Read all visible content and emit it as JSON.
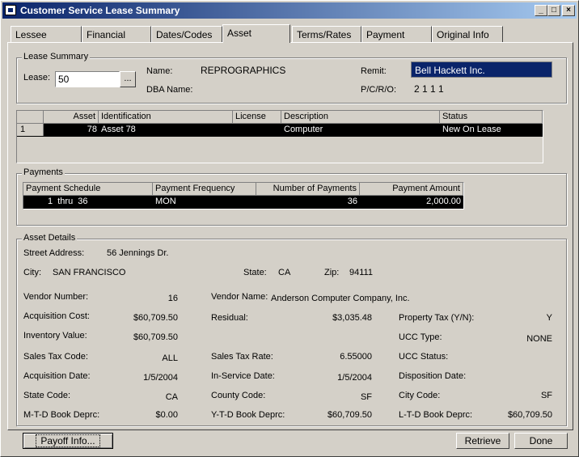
{
  "window": {
    "title": "Customer Service Lease Summary"
  },
  "tabs": [
    {
      "label": "Lessee"
    },
    {
      "label": "Financial"
    },
    {
      "label": "Dates/Codes"
    },
    {
      "label": "Asset"
    },
    {
      "label": "Terms/Rates"
    },
    {
      "label": "Payment"
    },
    {
      "label": "Original Info"
    }
  ],
  "active_tab": "Asset",
  "lease_summary": {
    "group_label": "Lease Summary",
    "lease_label": "Lease:",
    "lease_value": "50",
    "lookup_label": "...",
    "name_label": "Name:",
    "name_value": "REPROGRAPHICS",
    "dba_label": "DBA Name:",
    "dba_value": "",
    "remit_label": "Remit:",
    "remit_value": "Bell Hackett Inc.",
    "pcro_label": "P/C/R/O:",
    "pcro_value": "2 1 1 1"
  },
  "asset_table": {
    "headers": {
      "asset": "Asset",
      "identification": "Identification",
      "license": "License",
      "description": "Description",
      "status": "Status"
    },
    "rows": [
      {
        "row": "1",
        "asset": "78",
        "identification": "Asset 78",
        "license": "",
        "description": "Computer",
        "status": "New On Lease"
      }
    ]
  },
  "payments": {
    "group_label": "Payments",
    "headers": {
      "schedule": "Payment Schedule",
      "frequency": "Payment Frequency",
      "number": "Number of Payments",
      "amount": "Payment Amount"
    },
    "rows": [
      {
        "schedule": "1  thru  36",
        "frequency": "MON",
        "number": "36",
        "amount": "2,000.00"
      }
    ]
  },
  "asset_details": {
    "group_label": "Asset Details",
    "street_label": "Street Address:",
    "street_value": "56 Jennings Dr.",
    "city_label": "City:",
    "city_value": "SAN FRANCISCO",
    "state_label": "State:",
    "state_value": "CA",
    "zip_label": "Zip:",
    "zip_value": "94111",
    "vendor_number_label": "Vendor Number:",
    "vendor_number_value": "16",
    "vendor_name_label": "Vendor Name:",
    "vendor_name_value": "Anderson Computer Company, Inc.",
    "acq_cost_label": "Acquisition Cost:",
    "acq_cost_value": "$60,709.50",
    "residual_label": "Residual:",
    "residual_value": "$3,035.48",
    "prop_tax_label": "Property Tax (Y/N):",
    "prop_tax_value": "Y",
    "inventory_label": "Inventory Value:",
    "inventory_value": "$60,709.50",
    "ucc_type_label": "UCC Type:",
    "ucc_type_value": "NONE",
    "sales_tax_code_label": "Sales Tax Code:",
    "sales_tax_code_value": "ALL",
    "sales_tax_rate_label": "Sales Tax Rate:",
    "sales_tax_rate_value": "6.55000",
    "ucc_status_label": "UCC Status:",
    "ucc_status_value": "",
    "acq_date_label": "Acquisition Date:",
    "acq_date_value": "1/5/2004",
    "in_service_label": "In-Service Date:",
    "in_service_value": "1/5/2004",
    "disposition_label": "Disposition Date:",
    "disposition_value": "",
    "state_code_label": "State Code:",
    "state_code_value": "CA",
    "county_code_label": "County Code:",
    "county_code_value": "SF",
    "city_code_label": "City Code:",
    "city_code_value": "SF",
    "mtd_label": "M-T-D Book Deprc:",
    "mtd_value": "$0.00",
    "ytd_label": "Y-T-D Book Deprc:",
    "ytd_value": "$60,709.50",
    "ltd_label": "L-T-D Book Deprc:",
    "ltd_value": "$60,709.50"
  },
  "buttons": {
    "payoff": "Payoff Info...",
    "retrieve": "Retrieve",
    "done": "Done"
  },
  "colors": {
    "title_start": "#0a246a",
    "title_end": "#a6caf0",
    "remit_bg": "#0a246a",
    "selected_row": "#000000"
  }
}
